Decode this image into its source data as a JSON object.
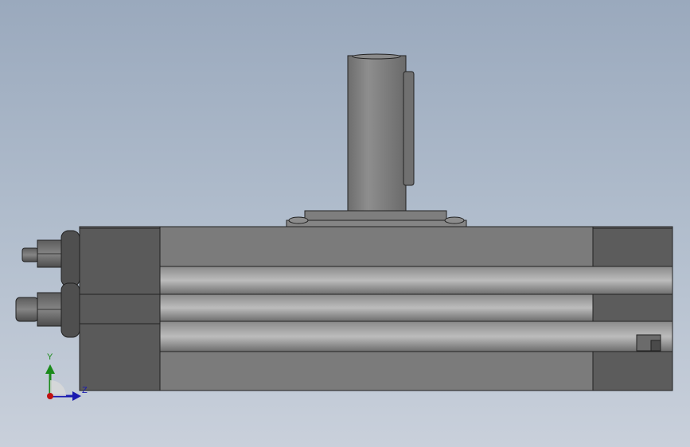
{
  "viewport": {
    "background_top": "#9aa9bd",
    "background_bottom": "#c9d0db"
  },
  "model": {
    "description_icon": "rotary-actuator-model",
    "body_color": "#7b7b7b",
    "dark_color": "#5a5a5a"
  },
  "triad": {
    "y_label": "Y",
    "z_label": "Z",
    "y_color": "#1a8a1a",
    "z_color": "#1a1ab0",
    "origin_color": "#c01010"
  }
}
